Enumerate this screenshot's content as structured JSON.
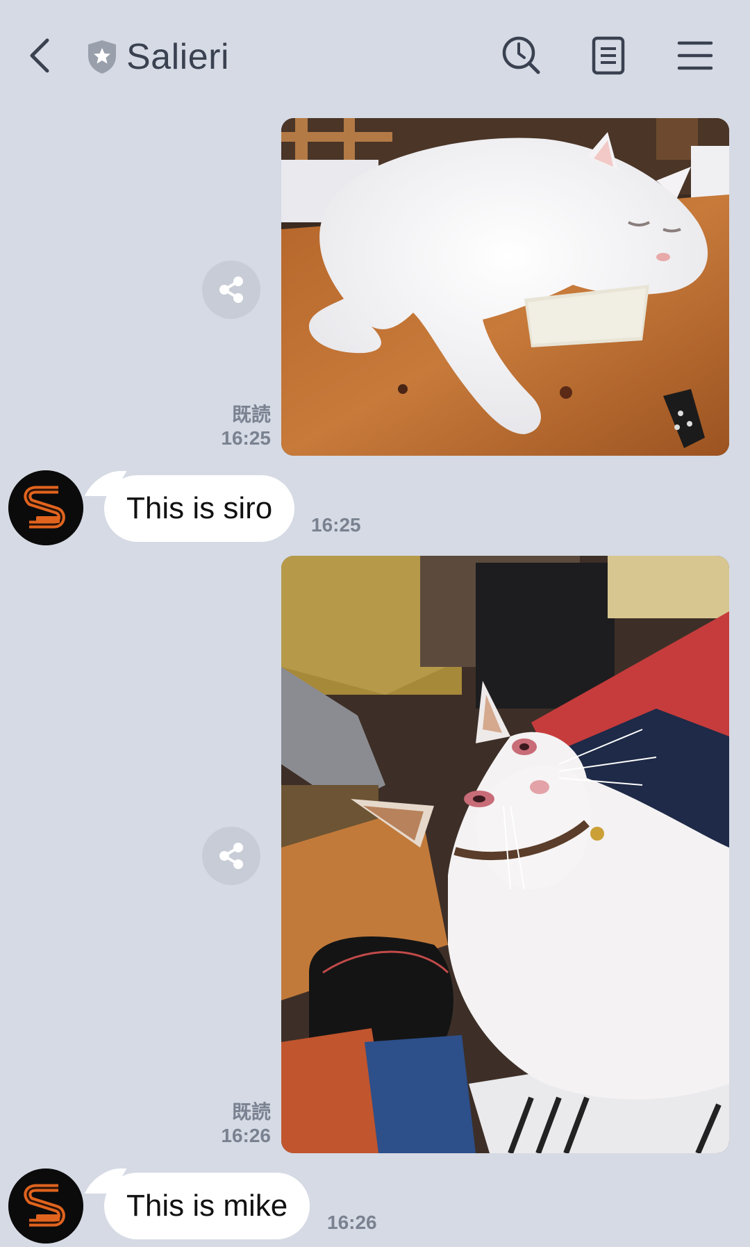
{
  "header": {
    "title": "Salieri"
  },
  "messages": [
    {
      "type": "photo",
      "read_label": "既読",
      "time": "16:25",
      "subject": "white cat sleeping on wooden table"
    },
    {
      "type": "text",
      "text": "This is siro",
      "time": "16:25"
    },
    {
      "type": "photo",
      "read_label": "既読",
      "time": "16:26",
      "subject": "calico cat looking up"
    },
    {
      "type": "text",
      "text": "This is mike",
      "time": "16:26"
    }
  ],
  "colors": {
    "background": "#d5dae4",
    "bubble": "#ffffff",
    "icon": "#3a4150",
    "meta_text": "#7a8291"
  }
}
